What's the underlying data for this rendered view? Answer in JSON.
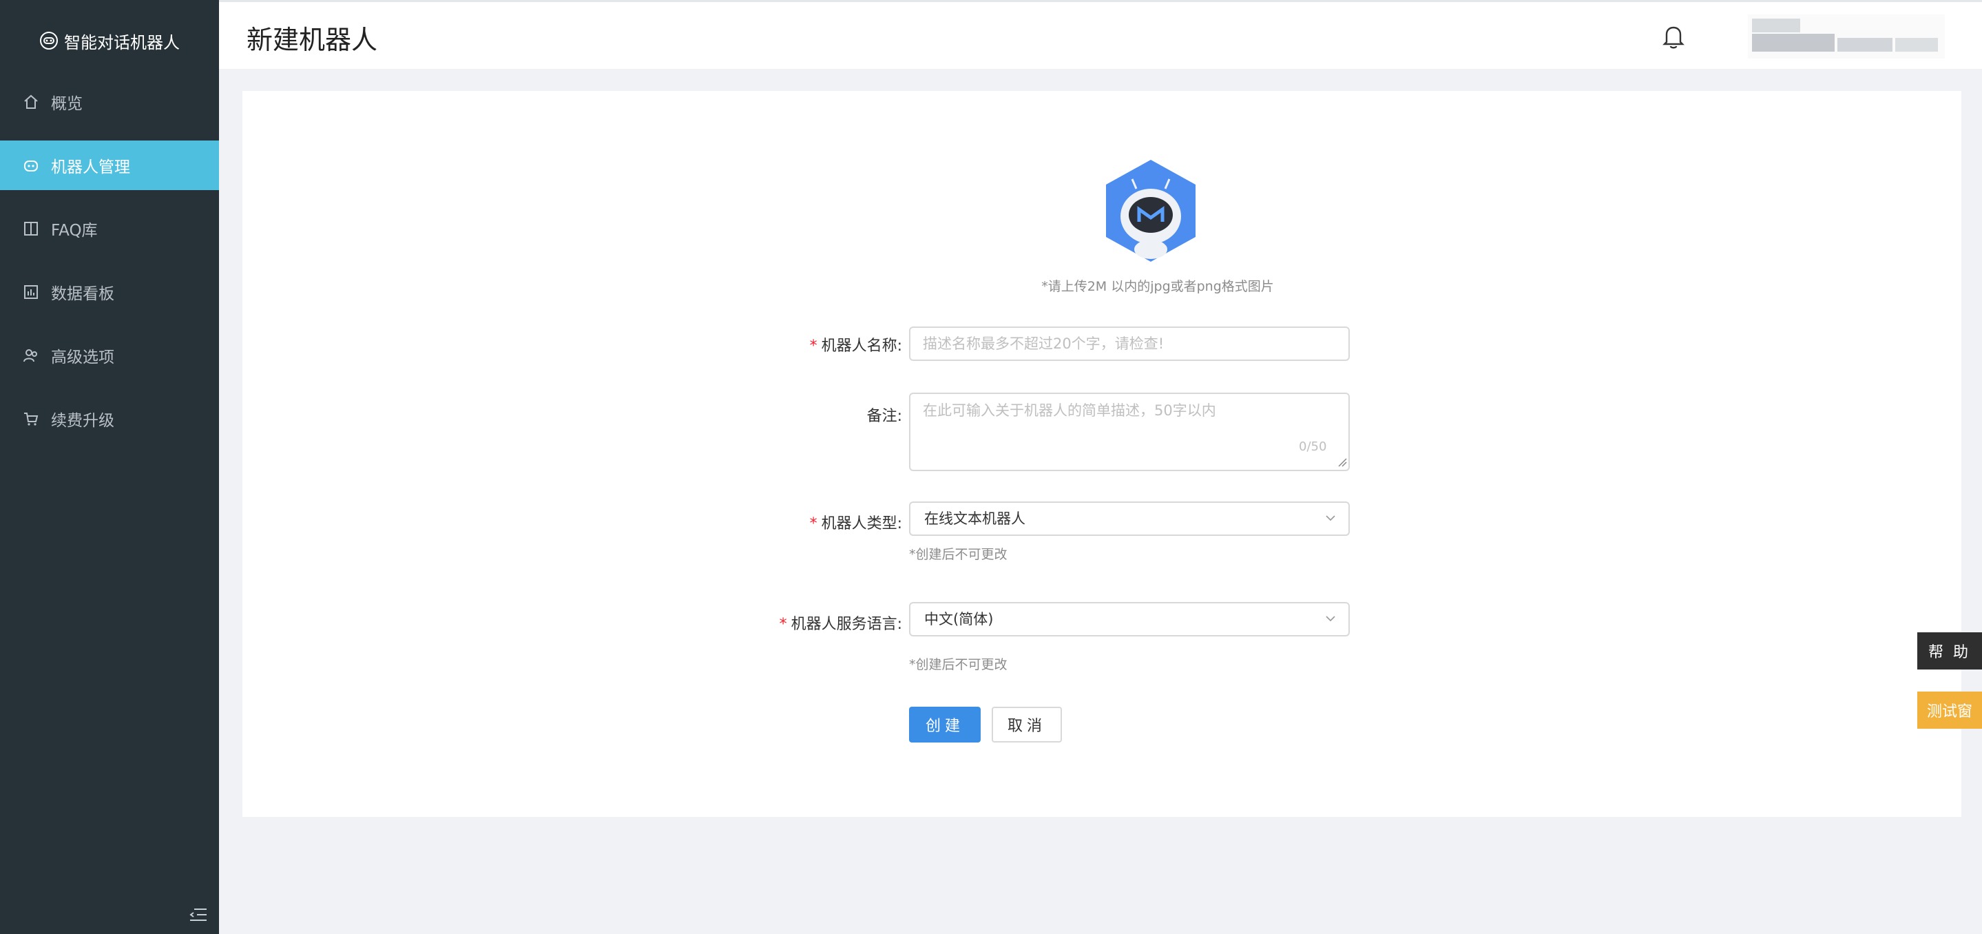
{
  "app": {
    "name": "智能对话机器人"
  },
  "sidebar": {
    "items": [
      {
        "label": "概览",
        "icon": "home-icon"
      },
      {
        "label": "机器人管理",
        "icon": "robot-icon",
        "active": true
      },
      {
        "label": "FAQ库",
        "icon": "book-icon"
      },
      {
        "label": "数据看板",
        "icon": "chart-icon"
      },
      {
        "label": "高级选项",
        "icon": "users-icon"
      },
      {
        "label": "续费升级",
        "icon": "cart-icon"
      }
    ]
  },
  "header": {
    "title": "新建机器人"
  },
  "form": {
    "upload_tip": "*请上传2M 以内的jpg或者png格式图片",
    "name": {
      "label": "机器人名称:",
      "required": true,
      "placeholder": "描述名称最多不超过20个字，请检查!",
      "value": ""
    },
    "remark": {
      "label": "备注:",
      "placeholder": "在此可输入关于机器人的简单描述，50字以内",
      "value": "",
      "counter": "0/50"
    },
    "type": {
      "label": "机器人类型:",
      "required": true,
      "value": "在线文本机器人",
      "hint": "*创建后不可更改"
    },
    "language": {
      "label": "机器人服务语言:",
      "required": true,
      "value": "中文(简体)",
      "hint": "*创建后不可更改"
    },
    "create_label": "创建",
    "cancel_label": "取消"
  },
  "floating": {
    "help_label": "帮助",
    "test_label": "测试窗"
  },
  "colors": {
    "sidebar_bg": "#263238",
    "active_bg": "#4fbfe0",
    "primary": "#3a8ee6",
    "test_tab": "#f2b13a"
  }
}
